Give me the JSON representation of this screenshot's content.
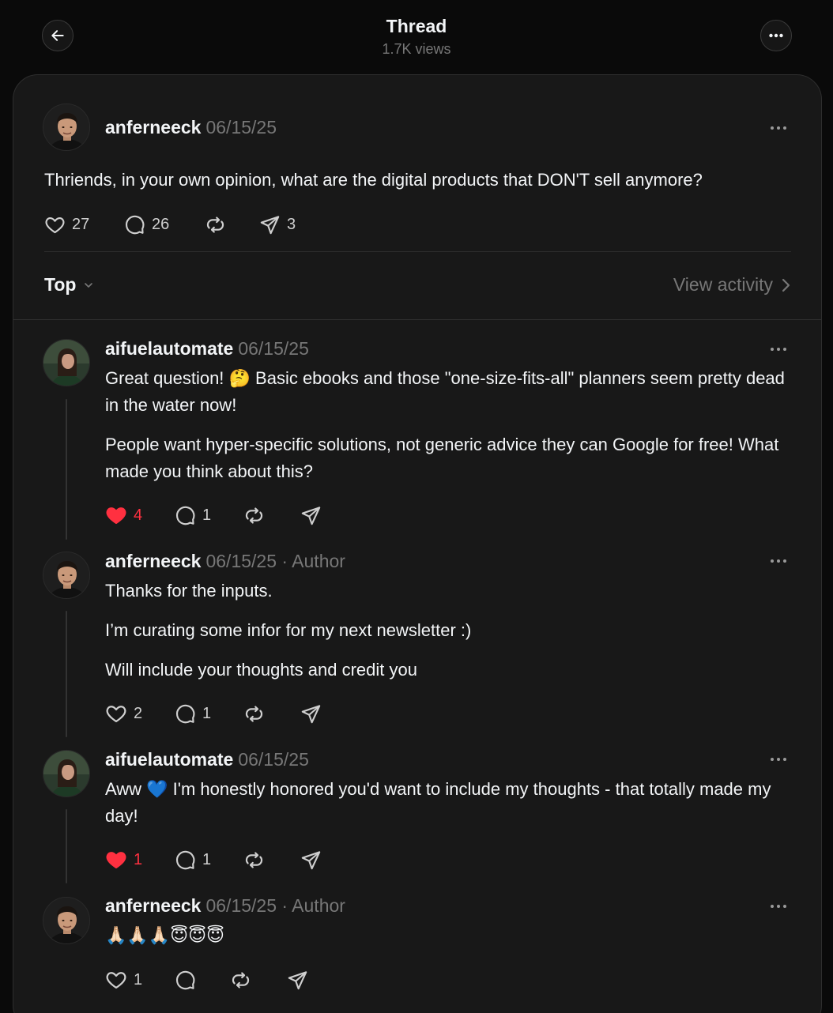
{
  "header": {
    "title": "Thread",
    "views": "1.7K views",
    "back_icon": "arrow-left-icon",
    "more_icon": "more-horizontal-icon"
  },
  "original_post": {
    "username": "anferneeck",
    "date": "06/15/25",
    "text": "Thriends, in your own opinion, what are the digital products that DON'T sell anymore?",
    "likes": "27",
    "replies": "26",
    "shares": "3"
  },
  "sort": {
    "label": "Top",
    "view_activity": "View activity"
  },
  "replies": [
    {
      "username": "aifuelautomate",
      "date": "06/15/25",
      "paragraphs": [
        "Great question! 🤔 Basic ebooks and those \"one-size-fits-all\" planners seem pretty dead in the water now!",
        "People want hyper-specific solutions, not generic advice they can Google for free! What made you think about this?"
      ],
      "likes": "4",
      "liked": true,
      "replies": "1"
    },
    {
      "username": "anferneeck",
      "date": "06/15/25",
      "author_tag": "· Author",
      "paragraphs": [
        "Thanks for the inputs.",
        "I’m curating some infor for my next newsletter :)",
        "Will include your thoughts and credit you"
      ],
      "likes": "2",
      "liked": false,
      "replies": "1"
    },
    {
      "username": "aifuelautomate",
      "date": "06/15/25",
      "paragraphs": [
        "Aww 💙 I'm honestly honored you'd want to include my thoughts - that totally made my day!"
      ],
      "likes": "1",
      "liked": true,
      "replies": "1"
    },
    {
      "username": "anferneeck",
      "date": "06/15/25",
      "author_tag": "· Author",
      "paragraphs": [
        "🙏🏻🙏🏻🙏🏻😇😇😇"
      ],
      "likes": "1",
      "liked": false
    }
  ],
  "colors": {
    "background": "#0a0a0a",
    "panel": "#181818",
    "like_active": "#ff3040",
    "muted_text": "#777777"
  }
}
